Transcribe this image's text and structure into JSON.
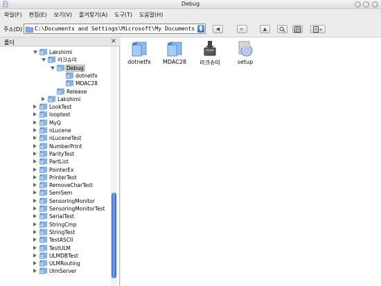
{
  "window": {
    "title": "Debug"
  },
  "menu": [
    "파일(F)",
    "편집(E)",
    "보기(V)",
    "즐겨찾기(A)",
    "도구(T)",
    "도움말(H)"
  ],
  "address": {
    "label": "주소(D)",
    "path": "C:\\Documents and Settings\\Microsoft\\My Documents\\Visual S"
  },
  "folder_pane": {
    "title": "폴더",
    "close": "×",
    "tree": [
      {
        "label": "Lakshimi",
        "state": "expanded"
      },
      {
        "label": "라크슈미",
        "state": "expanded"
      },
      {
        "label": "Debug",
        "state": "expanded",
        "selected": true
      },
      {
        "label": "dotnetfx",
        "state": "none"
      },
      {
        "label": "MDAC28",
        "state": "none"
      },
      {
        "label": "Release",
        "state": "none"
      },
      {
        "label": "Lakshimi",
        "state": "collapsed"
      },
      {
        "label": "LookTest",
        "state": "collapsed"
      },
      {
        "label": "looptest",
        "state": "collapsed"
      },
      {
        "label": "MyQ",
        "state": "collapsed"
      },
      {
        "label": "nLucene",
        "state": "collapsed"
      },
      {
        "label": "nLuceneTest",
        "state": "collapsed"
      },
      {
        "label": "NumberPrint",
        "state": "collapsed"
      },
      {
        "label": "ParityTest",
        "state": "collapsed"
      },
      {
        "label": "PartList",
        "state": "collapsed"
      },
      {
        "label": "PointerEx",
        "state": "collapsed"
      },
      {
        "label": "PrinterTest",
        "state": "collapsed"
      },
      {
        "label": "RemoveCharTest",
        "state": "collapsed"
      },
      {
        "label": "SemSem",
        "state": "collapsed"
      },
      {
        "label": "SensoringMonitor",
        "state": "collapsed"
      },
      {
        "label": "SensoringMonitorTest",
        "state": "collapsed"
      },
      {
        "label": "SerialTest",
        "state": "collapsed"
      },
      {
        "label": "StringCmp",
        "state": "collapsed"
      },
      {
        "label": "StringTest",
        "state": "collapsed"
      },
      {
        "label": "TestASCII",
        "state": "collapsed"
      },
      {
        "label": "TestULM",
        "state": "collapsed"
      },
      {
        "label": "ULMDBTest",
        "state": "collapsed"
      },
      {
        "label": "ULMRouting",
        "state": "collapsed"
      },
      {
        "label": "UlmServer",
        "state": "collapsed"
      }
    ]
  },
  "files": [
    {
      "name": "dotnetfx",
      "icon": "folder-icon"
    },
    {
      "name": "MDAC28",
      "icon": "folder-icon"
    },
    {
      "name": "라크슈미",
      "icon": "installer-icon"
    },
    {
      "name": "setup",
      "icon": "setup-cd-icon"
    }
  ],
  "colors": {
    "selection": "#c7c7c7",
    "scroll_thumb": "#3d6fd6",
    "folder": "#7fb0e8"
  }
}
